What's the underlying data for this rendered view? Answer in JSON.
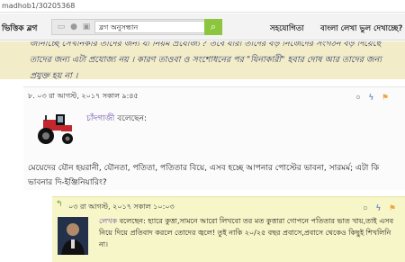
{
  "browser": {
    "url": "madhob1/30205368"
  },
  "header": {
    "site_label": "ভিত্তিক ব্লগ",
    "search_placeholder": "ব্লগ অনুসন্ধান",
    "nav": [
      "সহযোগিতা",
      "বাংলা লেখা ভুল দেখাচ্ছে?"
    ]
  },
  "quote_text": "জানাচ্ছে সেখানকার তাদের জন্য যা নিয়ম প্রযোজ্য ? তবে যারা তাদের বড় নিজেদের সংগঠন বড় দিয়েছে তাদের জন্য এটা প্রযোজ্য নয় । কারণ তাওবা ও সংশোধনের পর \"যিনাকারী\" হবার দোষ আর তাদের জন্য প্রযুক্ত হয় না ।",
  "comment1": {
    "header": "৮.  ০৩ রা আগস্ট, ২০১৭ সকাল ৯:৪৫",
    "vote_count": "০",
    "author_name": "চাঁদগাজী",
    "author_suffix": " বলেছেন:",
    "body": "মেয়েদের যৌন হয়রানী, যৌনতা, পতিতা, পতিতার বিয়ে, এসব হচ্ছে আপনার পোস্টের ভাবনা, সারমর্ম; এটা কি ভাবনার দি-ইঞ্জিনিয়ারিং?"
  },
  "comment2": {
    "header": "০৩ রা আগস্ট, ২০১৭ সকাল ১০:০৩",
    "vote_count": "০",
    "author_name": "লেখক",
    "author_suffix": " বলেছেন:",
    "body": "হ্যারে কুত্তা,সামনে আরো লিখবো তর মত কুত্তারা গোপনে পতিতার ভাত খায়,তাই এসব নিয়ে দিয়ে প্রতিবাদ করলে তোদের জ্বলে! তুই নাকি ২০/২৫ বছর প্রবাসে,প্রবাসে থেকেও কিছুই শিখলিনি না।"
  },
  "icons": [
    "lock-icon",
    "user-icon",
    "home-icon",
    "search-icon",
    "bolt-icon",
    "flag-icon",
    "reply-arrow-icon"
  ]
}
